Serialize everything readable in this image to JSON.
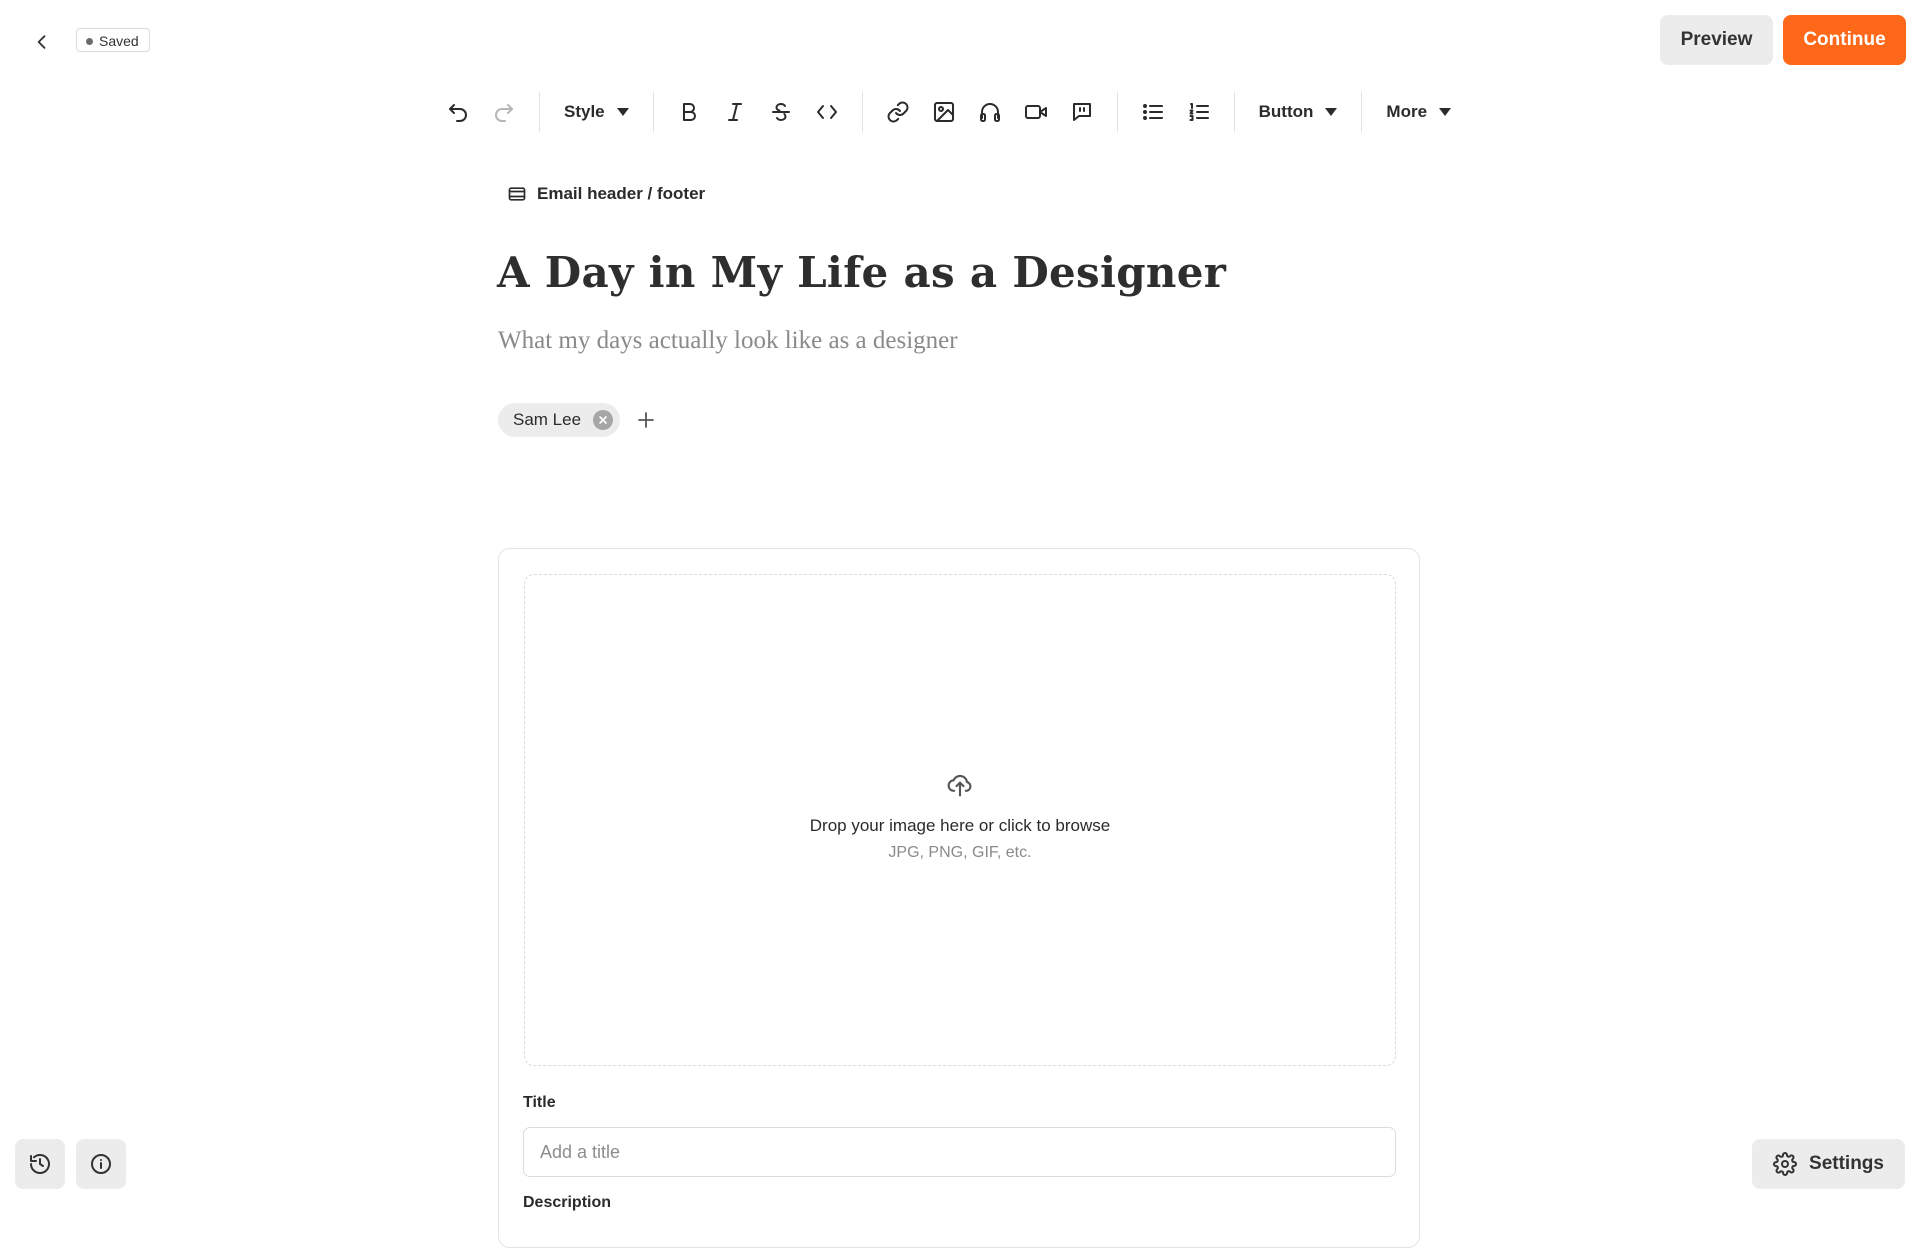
{
  "topbar": {
    "back_icon": "chevron-left-icon",
    "status": "Saved",
    "preview_label": "Preview",
    "continue_label": "Continue",
    "accent_color": "#ff6719"
  },
  "toolbar": {
    "style_label": "Style",
    "button_label": "Button",
    "more_label": "More",
    "icons": [
      "undo-icon",
      "redo-icon",
      "bold-icon",
      "italic-icon",
      "strikethrough-icon",
      "code-icon",
      "link-icon",
      "image-icon",
      "audio-icon",
      "video-icon",
      "quote-comment-icon",
      "bullet-list-icon",
      "numbered-list-icon"
    ]
  },
  "post": {
    "email_header_footer": "Email header / footer",
    "title": "A Day in My Life as a Designer",
    "subtitle": "What my days actually look like as a designer",
    "authors": [
      "Sam Lee"
    ]
  },
  "image_block": {
    "drop_text": "Drop your image here or click to browse",
    "formats": "JPG, PNG, GIF, etc.",
    "title_label": "Title",
    "title_placeholder": "Add a title",
    "description_label": "Description"
  },
  "footer": {
    "history_icon": "history-icon",
    "info_icon": "info-icon",
    "settings_label": "Settings"
  }
}
